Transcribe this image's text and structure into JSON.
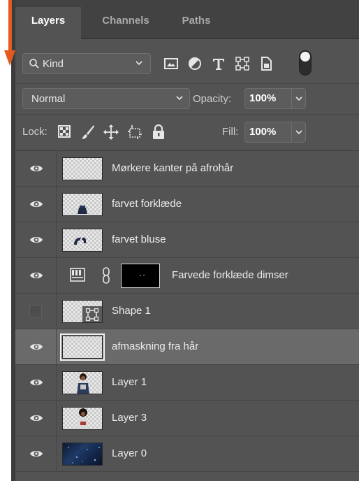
{
  "tabs": [
    {
      "label": "Layers",
      "active": true
    },
    {
      "label": "Channels",
      "active": false
    },
    {
      "label": "Paths",
      "active": false
    }
  ],
  "filter": {
    "kind_label": "Kind",
    "filter_icons": [
      "image-filter-icon",
      "adjustment-filter-icon",
      "type-filter-icon",
      "shape-filter-icon",
      "smart-object-filter-icon"
    ]
  },
  "blend": {
    "mode": "Normal",
    "opacity_label": "Opacity:",
    "opacity_value": "100%"
  },
  "lock": {
    "label": "Lock:",
    "icons": [
      "lock-transparent-pixels-icon",
      "lock-image-pixels-icon",
      "lock-position-icon",
      "lock-artboard-icon",
      "lock-all-icon"
    ],
    "fill_label": "Fill:",
    "fill_value": "100%"
  },
  "layers": [
    {
      "name": "Mørkere kanter på afrohår",
      "visible": true,
      "selected": false,
      "thumb": "transparent"
    },
    {
      "name": "farvet forklæde",
      "visible": true,
      "selected": false,
      "thumb": "apron"
    },
    {
      "name": "farvet bluse",
      "visible": true,
      "selected": false,
      "thumb": "blouse"
    },
    {
      "name": "Farvede forklæde dimser",
      "visible": true,
      "selected": false,
      "thumb": "adjustment"
    },
    {
      "name": "Shape 1",
      "visible": false,
      "selected": false,
      "thumb": "shape"
    },
    {
      "name": "afmaskning fra hår",
      "visible": true,
      "selected": true,
      "thumb": "transparent"
    },
    {
      "name": "Layer 1",
      "visible": true,
      "selected": false,
      "thumb": "person"
    },
    {
      "name": "Layer 3",
      "visible": true,
      "selected": false,
      "thumb": "person2"
    },
    {
      "name": "Layer 0",
      "visible": true,
      "selected": false,
      "thumb": "texture"
    }
  ],
  "colors": {
    "annotation_arrow": "#e35a1f",
    "panel_bg": "#535353",
    "selected_row": "#6a6a6a"
  }
}
